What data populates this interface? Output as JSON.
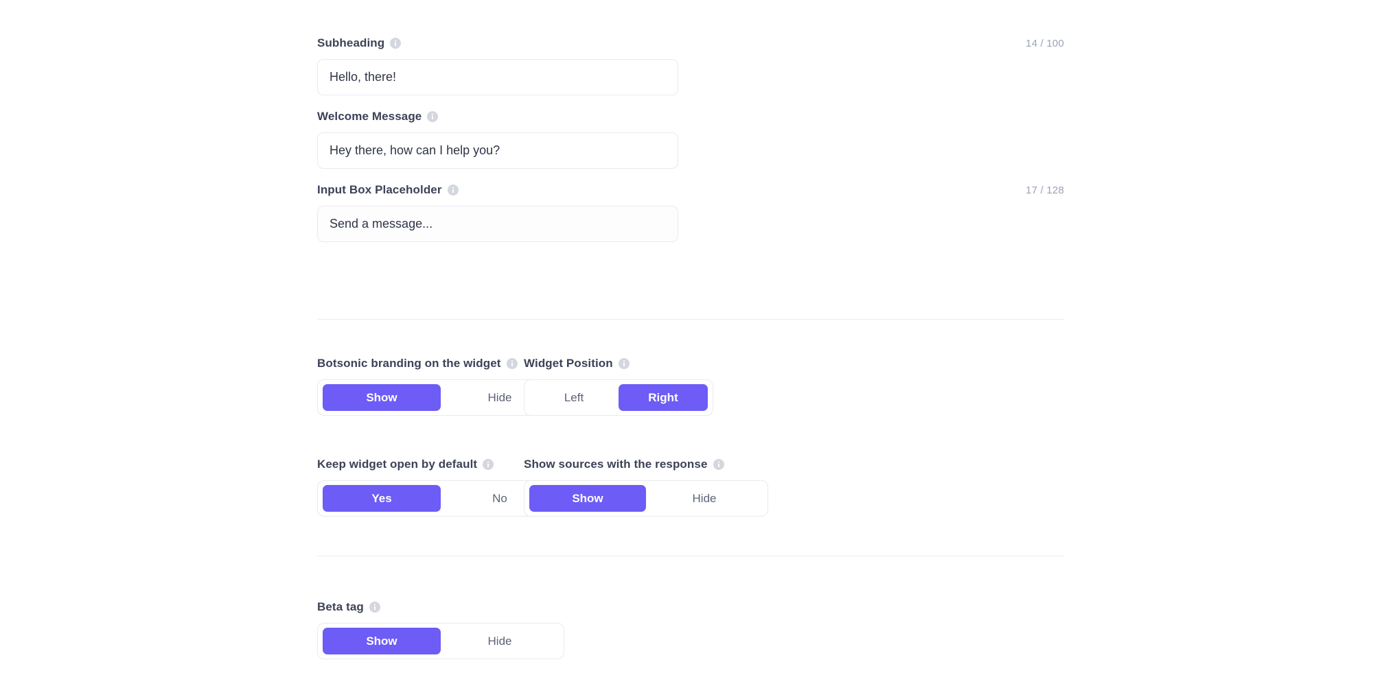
{
  "accent_color": "#6d5cf5",
  "label_color": "#3c4257",
  "counter_color": "#9aa2b5",
  "border_color": "#e9eaee",
  "divider_color": "#ececf0",
  "icons": {
    "info": "info-icon"
  },
  "fields": [
    {
      "id": "subheading",
      "label": "Subheading",
      "value": "Hello, there!",
      "placeholder": "Subheading",
      "counter": "14 / 100",
      "has_counter": true,
      "tinted": false
    },
    {
      "id": "welcome_message",
      "label": "Welcome Message",
      "value": "Hey there, how can I help you?",
      "placeholder": "Welcome Message",
      "counter": "",
      "has_counter": false,
      "tinted": false
    },
    {
      "id": "input_box_placeholder",
      "label": "Input Box Placeholder",
      "value": "Send a message...",
      "placeholder": "Send a message...",
      "counter": "17 / 128",
      "has_counter": true,
      "tinted": true
    }
  ],
  "toggles": {
    "branding": {
      "label": "Botsonic branding on the widget",
      "options": [
        "Show",
        "Hide"
      ],
      "selected": "Show"
    },
    "position": {
      "label": "Widget Position",
      "options": [
        "Left",
        "Right"
      ],
      "selected": "Right"
    },
    "keep_open": {
      "label": "Keep widget open by default",
      "options": [
        "Yes",
        "No"
      ],
      "selected": "Yes"
    },
    "show_sources": {
      "label": "Show sources with the response",
      "options": [
        "Show",
        "Hide"
      ],
      "selected": "Show"
    },
    "beta_tag": {
      "label": "Beta tag",
      "options": [
        "Show",
        "Hide"
      ],
      "selected": "Show"
    }
  }
}
